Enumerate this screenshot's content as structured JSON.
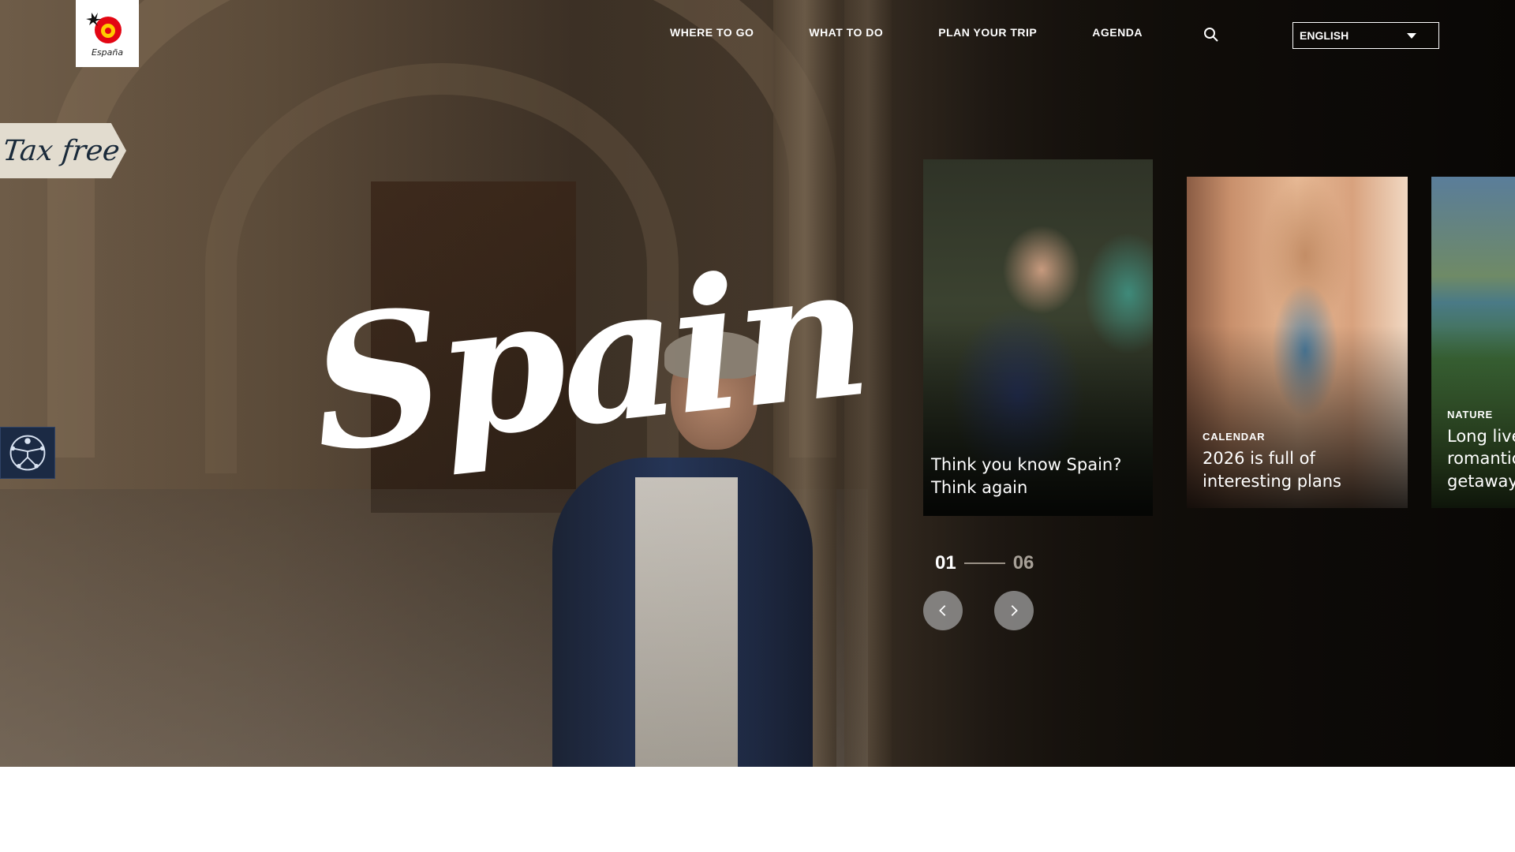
{
  "brand": {
    "logo_text": "España"
  },
  "header": {
    "nav": [
      {
        "label": "WHERE TO GO"
      },
      {
        "label": "WHAT TO DO"
      },
      {
        "label": "PLAN YOUR TRIP"
      },
      {
        "label": "AGENDA"
      }
    ],
    "search_icon": "search-icon",
    "language": {
      "selected": "ENGLISH"
    }
  },
  "tax_free": {
    "label": "Tax free"
  },
  "hero": {
    "title": "Spain"
  },
  "cards": [
    {
      "category": "",
      "title": "Think you know Spain? Think again"
    },
    {
      "category": "CALENDAR",
      "title": "2026 is full of interesting plans"
    },
    {
      "category": "NATURE",
      "title": "Long live a romantic getaway"
    }
  ],
  "pager": {
    "current": "01",
    "total": "06"
  },
  "colors": {
    "lang_border": "#ffffff",
    "a11y_bg": "#1b2a44",
    "taxfree_bg": "#e2dccf"
  }
}
